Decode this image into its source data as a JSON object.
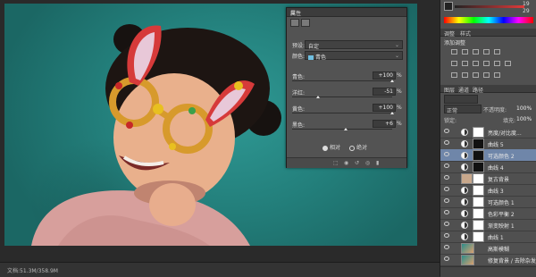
{
  "statusbar": {
    "doc": "文档:51.3M/358.9M"
  },
  "properties": {
    "title": "属性",
    "preset_label": "预设:",
    "preset_value": "自定",
    "color_label": "颜色:",
    "color_value": "青色",
    "sliders": [
      {
        "label": "青色:",
        "value": "+100",
        "unit": "%",
        "level": 1.0
      },
      {
        "label": "洋红:",
        "value": "-51",
        "unit": "%",
        "level": 0.245
      },
      {
        "label": "黄色:",
        "value": "+100",
        "unit": "%",
        "level": 1.0
      },
      {
        "label": "黑色:",
        "value": "+6",
        "unit": "%",
        "level": 0.53
      }
    ],
    "radio_relative": "相对",
    "radio_absolute": "绝对"
  },
  "color_panel": {
    "value1": "19",
    "value2": "29"
  },
  "adjustments": {
    "tab1": "调整",
    "tab2": "样式",
    "add_label": "添加调整"
  },
  "layers_panel": {
    "tabs": [
      "图层",
      "通道",
      "路径"
    ],
    "blend_mode": "正常",
    "opacity_label": "不透明度:",
    "opacity_value": "100%",
    "lock_label": "锁定:",
    "fill_label": "填充:",
    "fill_value": "100%",
    "layers": [
      {
        "name": "亮度/对比度...",
        "type": "adj",
        "mask": "white"
      },
      {
        "name": "曲线 5",
        "type": "adj",
        "mask": "dark"
      },
      {
        "name": "可选颜色 2",
        "type": "adj",
        "mask": "dark",
        "active": true
      },
      {
        "name": "曲线 4",
        "type": "adj",
        "mask": "dark"
      },
      {
        "name": "复古背景",
        "type": "solid"
      },
      {
        "name": "曲线 3",
        "type": "adj",
        "mask": "white"
      },
      {
        "name": "可选颜色 1",
        "type": "adj",
        "mask": "white"
      },
      {
        "name": "色彩平衡 2",
        "type": "adj",
        "mask": "white"
      },
      {
        "name": "渐变映射 1",
        "type": "adj",
        "mask": "white"
      },
      {
        "name": "曲线 1",
        "type": "adj",
        "mask": "white"
      },
      {
        "name": "高斯模糊",
        "type": "image"
      },
      {
        "name": "修复背景 / 去除杂发",
        "type": "image"
      }
    ]
  }
}
